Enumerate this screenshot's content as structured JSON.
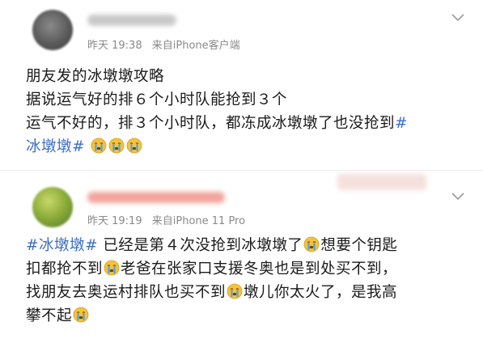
{
  "posts": [
    {
      "meta": {
        "time": "昨天 19:38",
        "source": "来自iPhone客户端"
      },
      "lines": [
        [
          {
            "t": "朋友发的冰墩墩攻略"
          }
        ],
        [
          {
            "t": "据说运气好的排６个小时队能抢到３个"
          }
        ],
        [
          {
            "t": "运气不好的，排３个小时队，都冻成冰墩墩了也没抢到"
          },
          {
            "t": "#",
            "tag": true
          }
        ],
        [
          {
            "t": "冰墩墩#",
            "tag": true
          },
          {
            "t": " "
          },
          {
            "emoji": true
          },
          {
            "emoji": true
          },
          {
            "emoji": true
          }
        ]
      ]
    },
    {
      "meta": {
        "time": "昨天 19:19",
        "source": "来自iPhone 11 Pro"
      },
      "lines": [
        [
          {
            "t": "#冰墩墩#",
            "tag": true
          },
          {
            "t": " 已经是第４次没抢到冰墩墩了"
          },
          {
            "emoji": true
          },
          {
            "t": "想要个钥匙"
          }
        ],
        [
          {
            "t": "扣都抢不到"
          },
          {
            "emoji": true
          },
          {
            "t": "老爸在张家口支援冬奥也是到处买不到，"
          }
        ],
        [
          {
            "t": "找朋友去奥运村排队也买不到"
          },
          {
            "emoji": true
          },
          {
            "t": "墩儿你太火了，是我高"
          }
        ],
        [
          {
            "t": "攀不起"
          },
          {
            "emoji": true
          }
        ]
      ]
    }
  ],
  "icons": {
    "emoji": "crying-emoji-icon",
    "menu": "chevron-down-icon"
  },
  "colors": {
    "hashtag": "#3b6ec4",
    "meta": "#8a8a8a"
  }
}
